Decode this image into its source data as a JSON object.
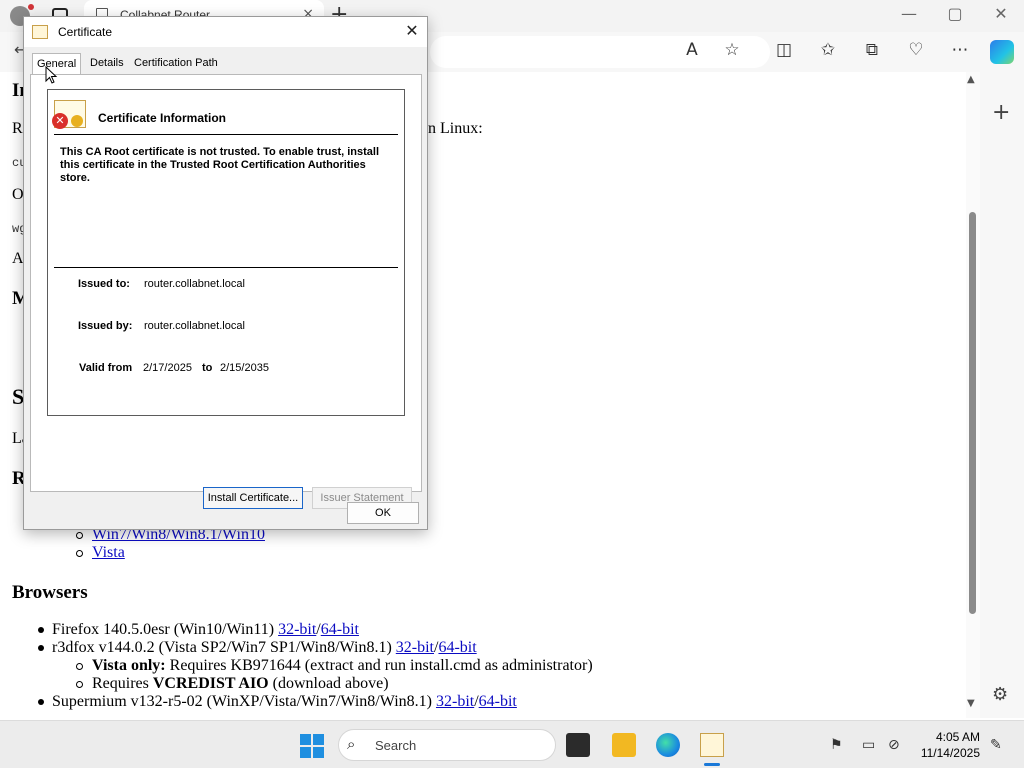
{
  "browser": {
    "tab_title": "Collabnet Router",
    "tab_close": "×",
    "new_tab": "+",
    "window_controls": {
      "minimize": "—",
      "maximize": "▢",
      "close": "✕"
    }
  },
  "page": {
    "fragments": [
      "In",
      "R",
      "cu",
      "O",
      "wg",
      "A",
      "M",
      "S",
      "La",
      "R"
    ],
    "linux_suffix": "n Linux:",
    "sub_links": [
      {
        "text": "Win7/Win8/Win8.1/Win10"
      },
      {
        "text": "Vista"
      }
    ],
    "browsers_heading": "Browsers",
    "items": {
      "firefox": {
        "text": "Firefox 140.5.0esr (Win10/Win11) ",
        "link1": "32-bit",
        "sep": "/",
        "link2": "64-bit"
      },
      "r3dfox": {
        "text": "r3dfox v144.0.2 (Vista SP2/Win7 SP1/Win8/Win8.1) ",
        "link1": "32-bit",
        "sep": "/",
        "link2": "64-bit"
      },
      "vista_only_label": "Vista only:",
      "vista_only_text": " Requires KB971644 (extract and run install.cmd as administrator)",
      "requires_prefix": "Requires ",
      "requires_bold": "VCREDIST AIO",
      "requires_suffix": " (download above)",
      "supermium": {
        "text": "Supermium v132-r5-02 (WinXP/Vista/Win7/Win8/Win8.1) ",
        "link1": "32-bit",
        "sep": "/",
        "link2": "64-bit"
      }
    }
  },
  "dialog": {
    "title": "Certificate",
    "close": "✕",
    "tabs": [
      {
        "label": "General",
        "active": true
      },
      {
        "label": "Details",
        "active": false
      },
      {
        "label": "Certification Path",
        "active": false
      }
    ],
    "info_heading": "Certificate Information",
    "warning": "This CA Root certificate is not trusted. To enable trust, install this certificate in the Trusted Root Certification Authorities store.",
    "issued_to_label": "Issued to:",
    "issued_to": "router.collabnet.local",
    "issued_by_label": "Issued by:",
    "issued_by": "router.collabnet.local",
    "valid_from_label": "Valid from",
    "valid_from": "2/17/2025",
    "valid_to_label": "to",
    "valid_to": "2/15/2035",
    "buttons": {
      "install": "Install Certificate...",
      "issuer": "Issuer Statement",
      "ok": "OK"
    }
  },
  "taskbar": {
    "search_placeholder": "Search",
    "time": "4:05 AM",
    "date": "11/14/2025"
  },
  "icons": {
    "search": "search-icon",
    "settings": "gear-icon",
    "error": "error-icon"
  },
  "colors": {
    "link": "#0b0bc2",
    "accent": "#1a65c9",
    "error": "#d9302a"
  }
}
